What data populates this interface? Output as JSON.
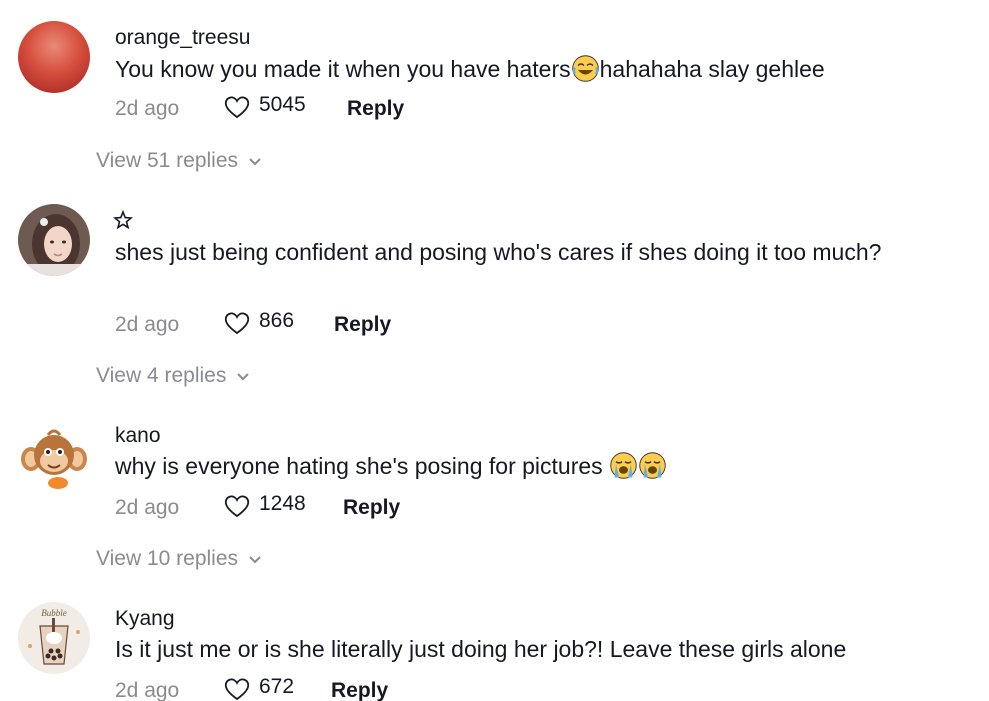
{
  "comments": [
    {
      "username": "orange_treesu",
      "text_before": "You know you made it when you have haters",
      "text_after": "hahahaha slay gehlee",
      "emoji": "laughing-tears-emoji",
      "time": "2d ago",
      "likes": "5045",
      "reply_label": "Reply",
      "view_replies": "View 51 replies"
    },
    {
      "username": "☆",
      "text": "shes just being confident and posing who's cares if shes doing it too much?",
      "time": "2d ago",
      "likes": "866",
      "reply_label": "Reply",
      "view_replies": "View 4 replies"
    },
    {
      "username": "kano",
      "text": "why is everyone hating she's posing for pictures ",
      "emoji": "loudly-crying-emoji",
      "time": "2d ago",
      "likes": "1248",
      "reply_label": "Reply",
      "view_replies": "View 10 replies"
    },
    {
      "username": "Kyang",
      "text": "Is it just me or is she literally just doing her job?! Leave these girls alone",
      "time": "2d ago",
      "likes": "672",
      "reply_label": "Reply"
    }
  ],
  "avatar_labels": {
    "kyang_cup_text": "Bubble"
  },
  "colors": {
    "text_primary": "#161823",
    "text_secondary": "#8a8b91",
    "avatar_orange": "#d94a3a"
  }
}
